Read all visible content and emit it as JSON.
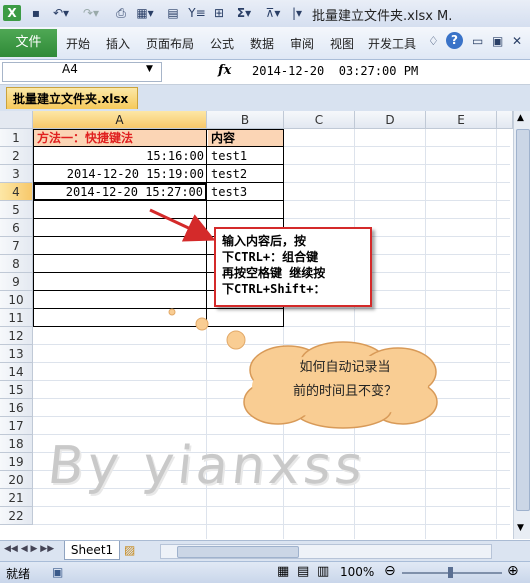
{
  "window": {
    "title": "批量建立文件夹.xlsx M."
  },
  "ribbon": {
    "file_tab": "文件",
    "tabs": [
      "开始",
      "插入",
      "页面布局",
      "公式",
      "数据",
      "审阅",
      "视图",
      "开发工具"
    ],
    "help_label": "?"
  },
  "formula_bar": {
    "name_box": "A4",
    "fx_label": "fx",
    "value": "2014-12-20  03:27:00 PM"
  },
  "document_tab": {
    "label": "批量建立文件夹.xlsx"
  },
  "grid": {
    "columns": [
      "A",
      "B",
      "C",
      "D",
      "E"
    ],
    "selected_column": "A",
    "rows": [
      "1",
      "2",
      "3",
      "4",
      "5",
      "6",
      "7",
      "8",
      "9",
      "10",
      "11",
      "12",
      "13",
      "14",
      "15",
      "16",
      "17",
      "18",
      "19",
      "20",
      "21",
      "22"
    ],
    "selected_row": "4",
    "cells": {
      "A1": "方法一：快捷键法",
      "B1": "内容",
      "A2": "15:16:00",
      "B2": "test1",
      "A3": "2014-12-20 15:19:00",
      "B3": "test2",
      "A4": "2014-12-20 15:27:00",
      "B4": "test3"
    }
  },
  "callout": {
    "lines": [
      "输入内容后，按",
      "下CTRL+：组合键",
      "再按空格键 继续按",
      "下CTRL+Shift+："
    ]
  },
  "cloud": {
    "lines": [
      "如何自动记录当",
      "前的时间且不变？"
    ]
  },
  "watermark": "By yianxss",
  "sheet_tabs": {
    "active": "Sheet1"
  },
  "status": {
    "ready": "就绪",
    "zoom": "100%"
  },
  "colors": {
    "header_red": "#e02020",
    "header_fill": "#fbd5b5",
    "selection_fill": "#f7c86a",
    "file_tab_green": "#2f8a37",
    "callout_border": "#d42a2a",
    "cloud_fill": "#f9cd93"
  }
}
